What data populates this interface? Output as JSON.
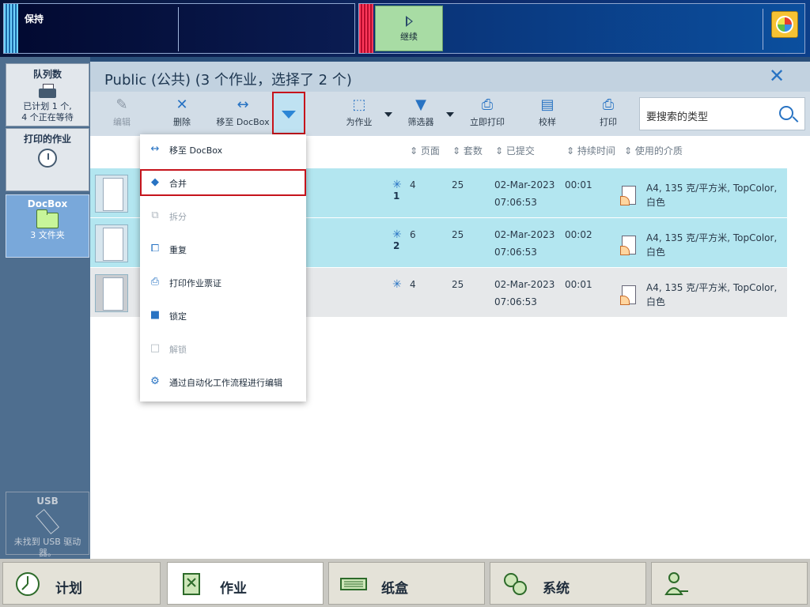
{
  "top_bar": {
    "hold_label": "保持",
    "resume_label": "继续"
  },
  "sidebar": {
    "queue": {
      "title": "队列数",
      "line1": "已计划 1 个,",
      "line2": "4 个正在等待"
    },
    "printed": {
      "title": "打印的作业"
    },
    "docbox": {
      "title": "DocBox",
      "sub": "3 文件夹"
    },
    "usb": {
      "title": "USB",
      "sub": "未找到 USB 驱动器。"
    }
  },
  "header": {
    "title": "Public (公共) (3 个作业，选择了 2 个)"
  },
  "toolbar": {
    "edit": "编辑",
    "delete": "删除",
    "move_docbox": "移至 DocBox",
    "for_job": "为作业",
    "filter": "筛选器",
    "print_now": "立即打印",
    "proof": "校样",
    "print": "打印",
    "search_placeholder": "要搜索的类型"
  },
  "columns": {
    "pages": "页面",
    "sets": "套数",
    "submitted": "已提交",
    "duration": "持续时间",
    "media": "使用的介质"
  },
  "jobs": [
    {
      "pages": "4",
      "count": "1",
      "sets": "25",
      "date": "02-Mar-2023",
      "time": "07:06:53",
      "duration": "00:01",
      "media": "A4, 135 克/平方米, TopColor,",
      "color": "白色"
    },
    {
      "pages": "6",
      "count": "2",
      "sets": "25",
      "date": "02-Mar-2023",
      "time": "07:06:53",
      "duration": "00:02",
      "media": "A4, 135 克/平方米, TopColor,",
      "color": "白色"
    },
    {
      "pages": "4",
      "count": "",
      "sets": "25",
      "date": "02-Mar-2023",
      "time": "07:06:53",
      "duration": "00:01",
      "media": "A4, 135 克/平方米, TopColor,",
      "color": "白色"
    }
  ],
  "menu": {
    "move_docbox": "移至 DocBox",
    "merge": "合并",
    "split": "拆分",
    "duplicate": "重复",
    "print_ticket": "打印作业票证",
    "lock": "锁定",
    "unlock": "解锁",
    "edit_workflow": "通过自动化工作流程进行编辑"
  },
  "bottom_tabs": {
    "plan": "计划",
    "jobs": "作业",
    "trays": "纸盒",
    "system": "系统"
  }
}
